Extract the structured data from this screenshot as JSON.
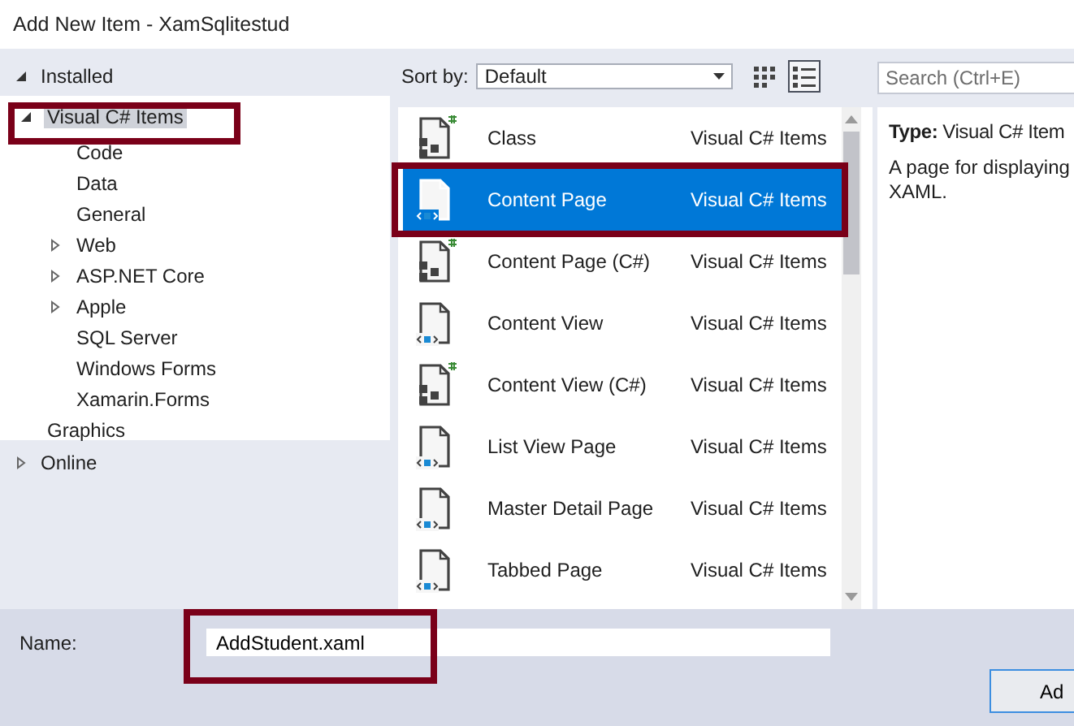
{
  "window": {
    "title": "Add New Item - XamSqlitestud"
  },
  "tree": [
    {
      "label": "Installed",
      "expanded": true,
      "children": [
        {
          "label": "Visual C# Items",
          "expanded": true,
          "selected": true,
          "children": [
            {
              "label": "Code",
              "selected": false
            },
            {
              "label": "Data",
              "selected": false
            },
            {
              "label": "General",
              "selected": false
            },
            {
              "label": "Web",
              "expanded": false,
              "selected": false
            },
            {
              "label": "ASP.NET Core",
              "expanded": false,
              "selected": false
            },
            {
              "label": "Apple",
              "expanded": false,
              "selected": false
            },
            {
              "label": "SQL Server",
              "selected": false
            },
            {
              "label": "Windows Forms",
              "selected": false
            },
            {
              "label": "Xamarin.Forms",
              "selected": false
            }
          ]
        },
        {
          "label": "Graphics",
          "selected": false
        }
      ]
    },
    {
      "label": "Online",
      "expanded": false
    }
  ],
  "toolbar": {
    "sort_label": "Sort by:",
    "sort_value": "Default",
    "views": [
      {
        "kind": "grid",
        "selected": false
      },
      {
        "kind": "list",
        "selected": true
      }
    ]
  },
  "search": {
    "placeholder": "Search (Ctrl+E)"
  },
  "templates": [
    {
      "kind": "csharp",
      "name": "Class",
      "type": "Visual C# Items",
      "selected": false
    },
    {
      "kind": "xaml",
      "name": "Content Page",
      "type": "Visual C# Items",
      "selected": true
    },
    {
      "kind": "csharp",
      "name": "Content Page (C#)",
      "type": "Visual C# Items",
      "selected": false
    },
    {
      "kind": "xaml",
      "name": "Content View",
      "type": "Visual C# Items",
      "selected": false
    },
    {
      "kind": "csharp",
      "name": "Content View (C#)",
      "type": "Visual C# Items",
      "selected": false
    },
    {
      "kind": "xaml",
      "name": "List View Page",
      "type": "Visual C# Items",
      "selected": false
    },
    {
      "kind": "xaml",
      "name": "Master Detail Page",
      "type": "Visual C# Items",
      "selected": false
    },
    {
      "kind": "xaml",
      "name": "Tabbed Page",
      "type": "Visual C# Items",
      "selected": false
    }
  ],
  "details": {
    "type_label": "Type:",
    "type_value": "Visual C# Item",
    "description": "A page for displaying XAML."
  },
  "name_field": {
    "label": "Name:",
    "value": "AddStudent.xaml"
  },
  "buttons": [
    "Ad"
  ]
}
